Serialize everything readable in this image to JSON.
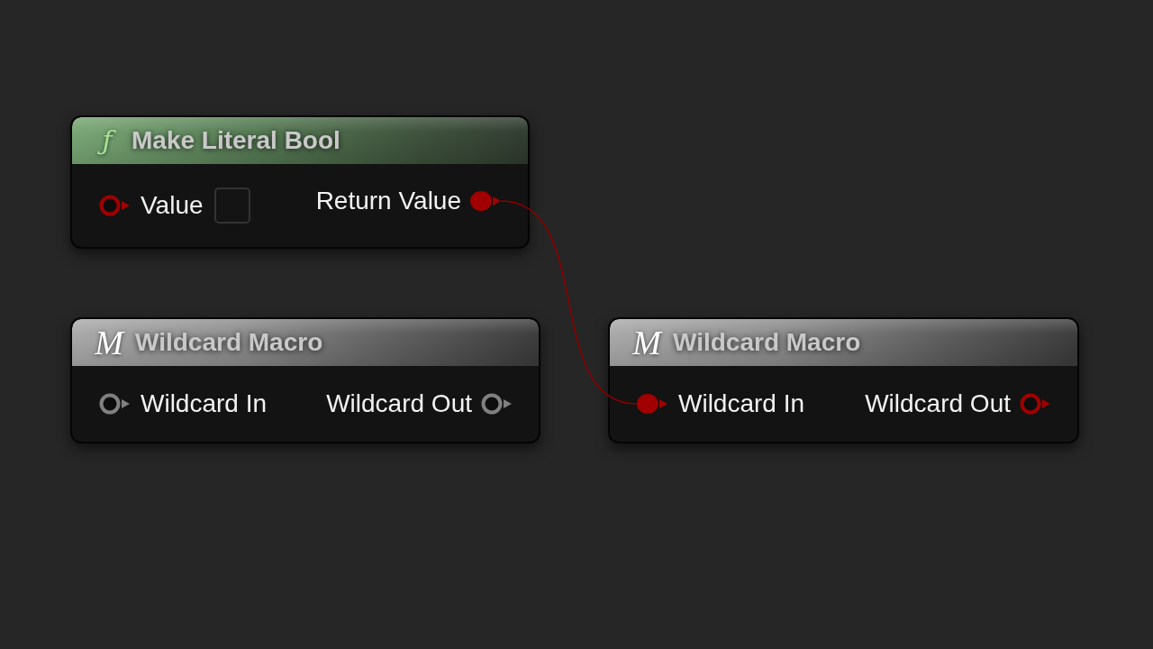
{
  "nodes": [
    {
      "kind": "function",
      "icon": "ƒ",
      "title": "Make Literal Bool",
      "inputs": [
        {
          "label": "Value",
          "color": "#a00000",
          "connected": false,
          "checkbox": {
            "checked": false
          }
        }
      ],
      "outputs": [
        {
          "label": "Return Value",
          "color": "#a00000",
          "connected": true
        }
      ]
    },
    {
      "kind": "macro",
      "icon": "M",
      "title": "Wildcard Macro",
      "inputs": [
        {
          "label": "Wildcard In",
          "color": "#808080",
          "connected": false
        }
      ],
      "outputs": [
        {
          "label": "Wildcard Out",
          "color": "#808080",
          "connected": false
        }
      ]
    },
    {
      "kind": "macro",
      "icon": "M",
      "title": "Wildcard Macro",
      "inputs": [
        {
          "label": "Wildcard In",
          "color": "#a00000",
          "connected": true
        }
      ],
      "outputs": [
        {
          "label": "Wildcard Out",
          "color": "#a00000",
          "connected": false
        }
      ]
    }
  ]
}
